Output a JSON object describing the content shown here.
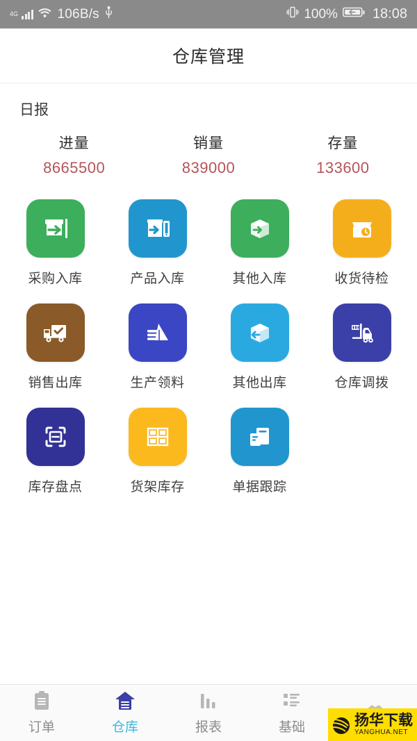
{
  "status_bar": {
    "network_generation": "4G",
    "speed": "106B/s",
    "battery_percent": "100%",
    "time": "18:08",
    "icons": [
      "signal-icon",
      "wifi-icon",
      "usb-icon",
      "vibrate-icon",
      "battery-charging-icon"
    ],
    "background": "#8a8a8a"
  },
  "header": {
    "title": "仓库管理"
  },
  "report": {
    "section_label": "日报",
    "value_color": "#b5545a",
    "stats": [
      {
        "label": "进量",
        "value": "8665500"
      },
      {
        "label": "销量",
        "value": "839000"
      },
      {
        "label": "存量",
        "value": "133600"
      }
    ]
  },
  "grid": {
    "items": [
      {
        "label": "采购入库",
        "icon": "box-arrow-in-icon",
        "color": "#3cae5c"
      },
      {
        "label": "产品入库",
        "icon": "product-arrow-in-icon",
        "color": "#2196ce"
      },
      {
        "label": "其他入库",
        "icon": "carton-arrow-in-icon",
        "color": "#3cae5c"
      },
      {
        "label": "收货待检",
        "icon": "box-clock-icon",
        "color": "#f5ae1b"
      },
      {
        "label": "销售出库",
        "icon": "truck-check-icon",
        "color": "#8a5a28"
      },
      {
        "label": "生产领料",
        "icon": "material-stack-icon",
        "color": "#3b46c4"
      },
      {
        "label": "其他出库",
        "icon": "carton-arrow-out-icon",
        "color": "#2aa9e0"
      },
      {
        "label": "仓库调拨",
        "icon": "forklift-icon",
        "color": "#3b3fa8"
      },
      {
        "label": "库存盘点",
        "icon": "scan-minus-icon",
        "color": "#323196"
      },
      {
        "label": "货架库存",
        "icon": "shelf-grid-icon",
        "color": "#fbb91e"
      },
      {
        "label": "单据跟踪",
        "icon": "documents-icon",
        "color": "#2196ce"
      }
    ]
  },
  "tabbar": {
    "active_color": "#39b9e0",
    "items": [
      {
        "label": "订单",
        "icon": "clipboard-icon",
        "active": false
      },
      {
        "label": "仓库",
        "icon": "warehouse-icon",
        "active": true
      },
      {
        "label": "报表",
        "icon": "bar-chart-icon",
        "active": false
      },
      {
        "label": "基础",
        "icon": "list-grid-icon",
        "active": false
      },
      {
        "label": "",
        "icon": "handshake-icon",
        "active": false
      }
    ]
  },
  "watermark": {
    "cn": "扬华下载",
    "en": "YANGHUA.NET",
    "background": "#FFDD00"
  }
}
